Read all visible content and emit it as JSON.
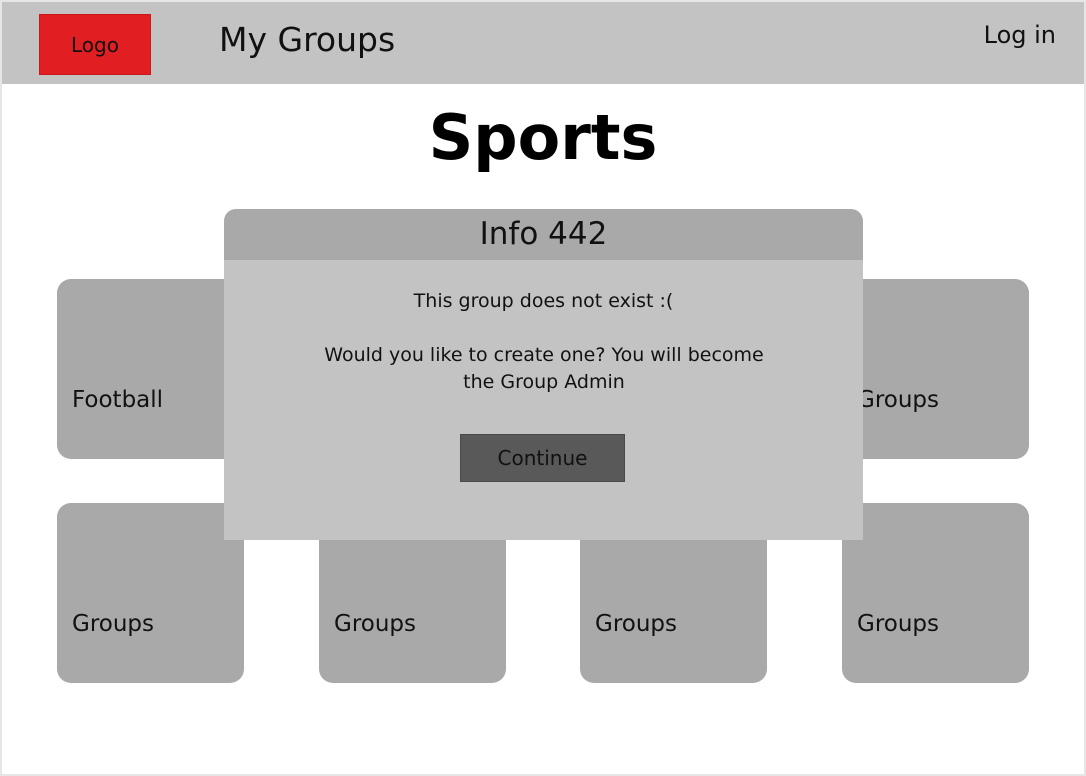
{
  "header": {
    "logo_text": "Logo",
    "title": "My Groups",
    "login_label": "Log in"
  },
  "page": {
    "title": "Sports"
  },
  "tiles": {
    "row1": [
      "Football",
      "Groups"
    ],
    "row2": [
      "Groups",
      "Groups",
      "Groups",
      "Groups"
    ]
  },
  "modal": {
    "title": "Info 442",
    "message": "This group does not exist :(",
    "prompt": "Would you like to create one? You will become the Group Admin",
    "continue_label": "Continue"
  },
  "colors": {
    "header_bg": "#c3c3c3",
    "logo_bg": "#e11f22",
    "tile_bg": "#a9a9a9",
    "modal_body_bg": "#c3c3c3",
    "button_bg": "#595959"
  }
}
